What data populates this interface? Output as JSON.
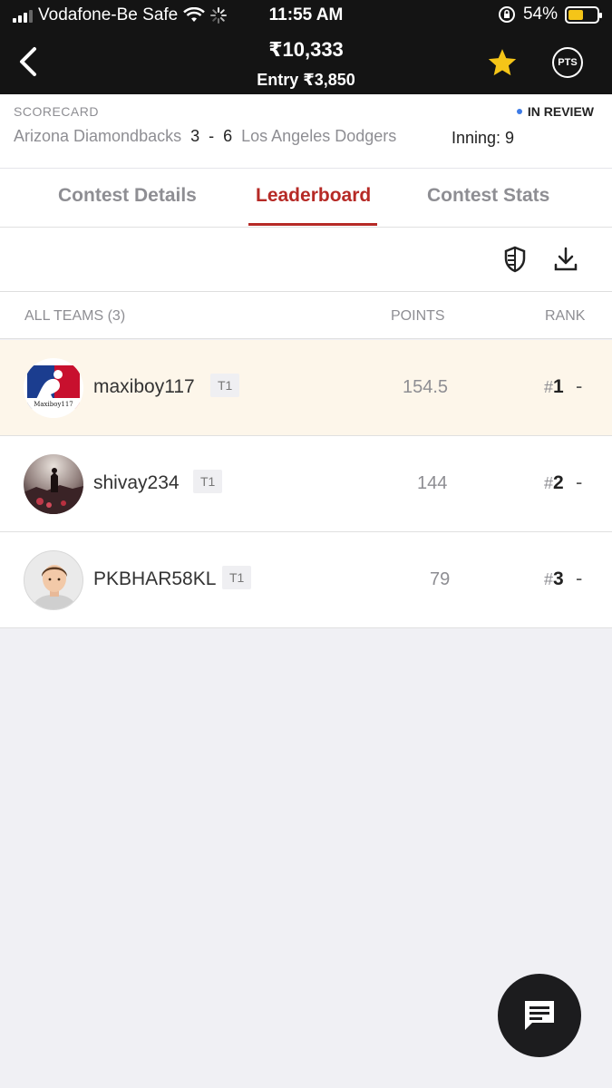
{
  "status_bar": {
    "carrier": "Vodafone-Be Safe",
    "time": "11:55 AM",
    "battery": "54%",
    "battery_level": 0.54
  },
  "header": {
    "prize": "₹10,333",
    "entry": "Entry ₹3,850",
    "pts_label": "PTS"
  },
  "scorecard": {
    "label": "SCORECARD",
    "status": "IN REVIEW",
    "team1": "Arizona Diamondbacks",
    "score1": "3",
    "separator": "-",
    "score2": "6",
    "team2": "Los Angeles Dodgers",
    "inning": "Inning: 9"
  },
  "tabs": [
    {
      "label": "Contest Details"
    },
    {
      "label": "Leaderboard"
    },
    {
      "label": "Contest Stats"
    }
  ],
  "leaderboard": {
    "header_teams": "ALL TEAMS (3)",
    "header_points": "POINTS",
    "header_rank": "RANK",
    "rows": [
      {
        "username": "maxiboy117",
        "team": "T1",
        "points": "154.5",
        "rank": "1",
        "change": "-",
        "avatar_text": "Maxiboy117"
      },
      {
        "username": "shivay234",
        "team": "T1",
        "points": "144",
        "rank": "2",
        "change": "-"
      },
      {
        "username": "PKBHAR58KL",
        "team": "T1",
        "points": "79",
        "rank": "3",
        "change": "-"
      }
    ]
  },
  "colors": {
    "accent": "#b62a26",
    "highlight_row": "#fdf6ea",
    "header_bg": "#141414",
    "star": "#f5c518"
  }
}
